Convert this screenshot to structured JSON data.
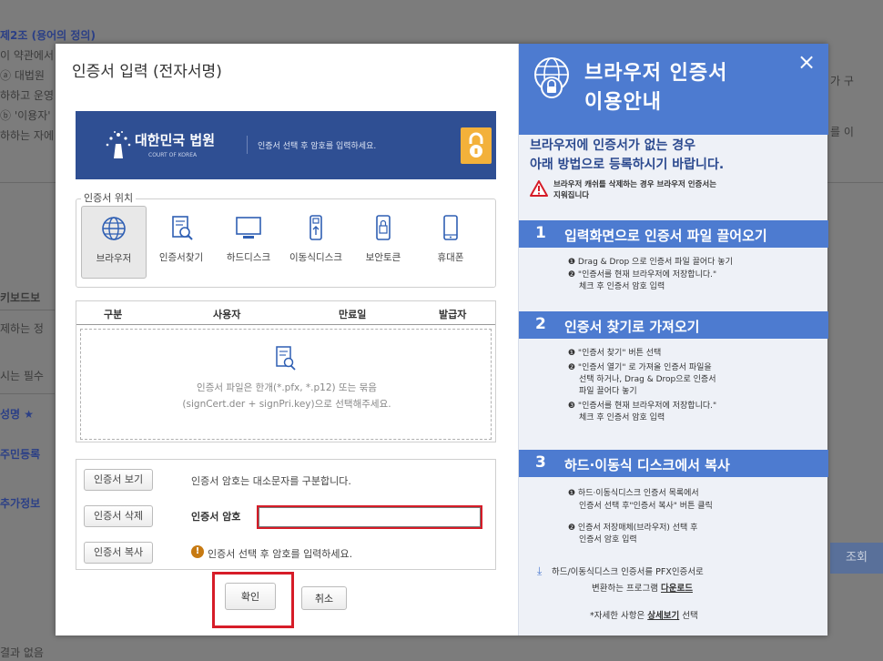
{
  "background": {
    "article_title": "제2조 (용어의 정의)",
    "lines": [
      "이 약관에서",
      "ⓐ 대법원",
      "하하고 운영",
      "ⓑ '이용자'",
      "하하는 자에"
    ],
    "right_frag1": "가 구",
    "right_frag2": "를 이",
    "left_labels": [
      "키보드보",
      "제하는 정",
      "시는 필수",
      "성명 ★",
      "주민등록",
      "추가정보"
    ],
    "search_button": "조회",
    "bottom_left": "결과 없음"
  },
  "dialog": {
    "title": "인증서 입력 (전자서명)",
    "banner": {
      "court_name": "대한민국 법원",
      "court_en": "COURT OF KOREA",
      "message": "인증서 선택 후 암호를 입력하세요."
    },
    "location": {
      "legend": "인증서 위치",
      "items": [
        {
          "label": "브라우저",
          "icon": "globe-icon"
        },
        {
          "label": "인증서찾기",
          "icon": "certificate-search-icon"
        },
        {
          "label": "하드디스크",
          "icon": "monitor-icon"
        },
        {
          "label": "이동식디스크",
          "icon": "usb-icon"
        },
        {
          "label": "보안토큰",
          "icon": "security-token-icon"
        },
        {
          "label": "휴대폰",
          "icon": "phone-icon"
        }
      ]
    },
    "table": {
      "columns": [
        "구분",
        "사용자",
        "만료일",
        "발급자"
      ],
      "empty_line1": "인증서 파일은 한개(*.pfx, *.p12) 또는 묶음",
      "empty_line2": "(signCert.der + signPri.key)으로 선택해주세요."
    },
    "actions": {
      "view_label": "인증서 보기",
      "view_note": "인증서 암호는 대소문자를 구분합니다.",
      "delete_label": "인증서 삭제",
      "password_label": "인증서 암호",
      "password_value": "",
      "copy_label": "인증서 복사",
      "copy_note": "인증서 선택 후 암호를 입력하세요."
    },
    "confirm_label": "확인",
    "cancel_label": "취소"
  },
  "guide": {
    "title_line1": "브라우저 인증서",
    "title_line2": "이용안내",
    "close": "×",
    "subtitle_line1": "브라우저에 인증서가 없는 경우",
    "subtitle_line2": "아래 방법으로 등록하시기 바랍니다.",
    "alert_line1": "브라우저 캐쉬를 삭제하는 경우 브라우저 인증서는",
    "alert_line2": "지워집니다",
    "steps": [
      {
        "num": "1",
        "title": "입력화면으로 인증서 파일 끌어오기",
        "lines": [
          "❶ Drag & Drop 으로 인증서 파일 끌어다 놓기",
          "❷ \"인증서를 현재 브라우저에 저장합니다.\"",
          "체크 후 인증서 암호 입력"
        ]
      },
      {
        "num": "2",
        "title": "인증서 찾기로 가져오기",
        "lines": [
          "❶ \"인증서 찾기\" 버튼 선택",
          "❷ \"인증서 열기\" 로 가져올 인증서 파일을",
          "선택 하거나, Drag & Drop으로 인증서",
          "파일 끌어다 놓기",
          "❸ \"인증서를 현재 브라우저에 저장합니다.\"",
          "체크 후 인증서 암호 입력"
        ]
      },
      {
        "num": "3",
        "title": "하드·이동식 디스크에서 복사",
        "lines": [
          "❶ 하드·이동식디스크 인증서 목록에서",
          "인증서 선택 후\"인증서 복사\" 버튼 클릭",
          "❷ 인증서 저장매체(브라우저) 선택 후",
          "인증서 암호 입력"
        ]
      }
    ],
    "download_line1": "하드/이동식디스크 인증서를 PFX인증서로",
    "download_line2_prefix": "변환하는 프로그램",
    "download_link": "다운로드",
    "more_prefix": "*자세한 사항은",
    "more_link": "상세보기",
    "more_suffix": "선택"
  }
}
